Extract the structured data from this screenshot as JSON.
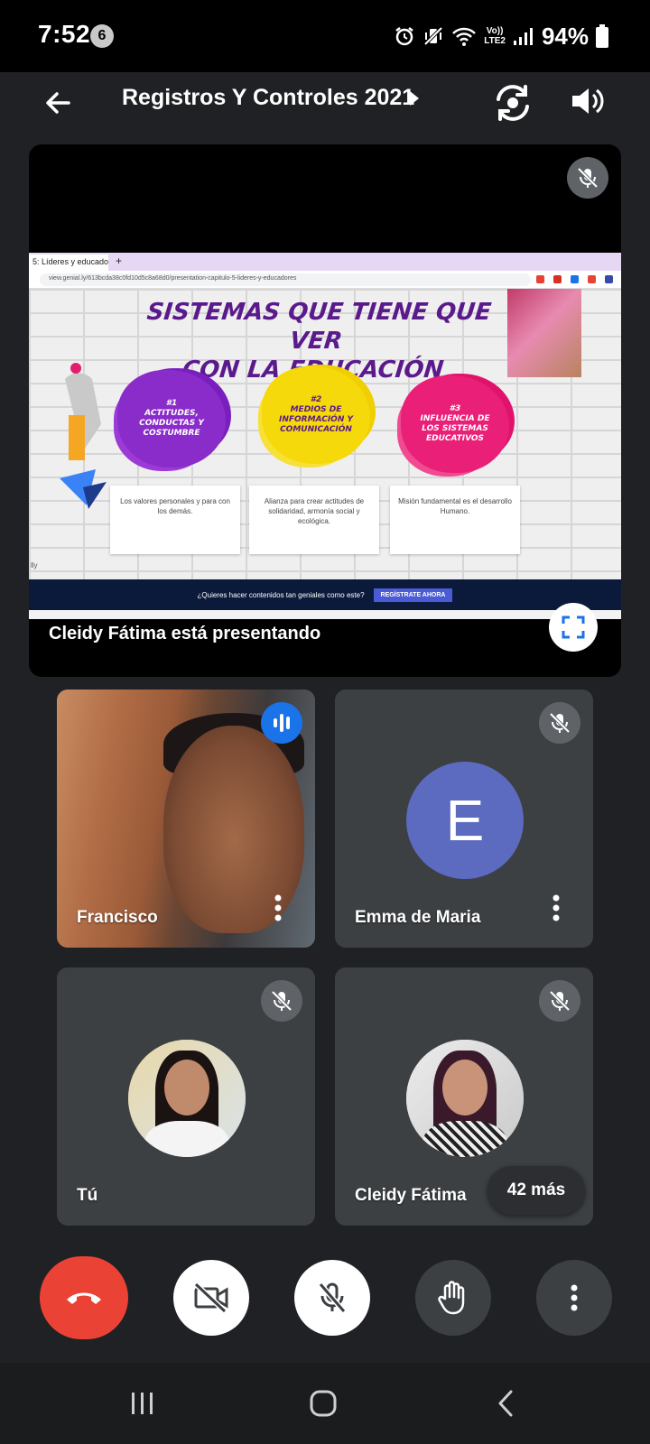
{
  "status_bar": {
    "time": "7:52",
    "notification_count": "6",
    "network_label_top": "Vo))",
    "network_label_bottom": "LTE2",
    "battery": "94%",
    "icons": [
      "alarm-icon",
      "vibrate-icon",
      "wifi-icon",
      "signal-icon",
      "battery-icon"
    ]
  },
  "top_bar": {
    "title": "Registros Y Controles 2021",
    "icons": [
      "back-arrow-icon",
      "caret-right-icon",
      "switch-camera-icon",
      "speaker-icon"
    ]
  },
  "presentation": {
    "presenting_label": "Cleidy Fátima está presentando",
    "browser": {
      "tab_label": "5: Líderes y educadores",
      "url": "view.genial.ly/613bcda38c0fd10d5c8a68d0/presentation-capitulo-5-lideres-y-educadores"
    },
    "slide": {
      "title_line1": "SISTEMAS QUE TIENE QUE VER",
      "title_line2": "CON LA EDUCACIÓN",
      "items": [
        {
          "number": "#1",
          "heading": "ACTITUDES, CONDUCTAS Y COSTUMBRE",
          "text": "Los valores personales y para con los demás."
        },
        {
          "number": "#2",
          "heading": "MEDIOS DE INFORMACIÓN Y COMUNICACIÓN",
          "text": "Alianza para crear actitudes de solidaridad, armonía social y ecológica."
        },
        {
          "number": "#3",
          "heading": "INFLUENCIA DE LOS SISTEMAS EDUCATIVOS",
          "text": "Misión fundamental es el desarrollo Humano."
        }
      ],
      "footer_mark": "lly"
    },
    "cta": {
      "question": "¿Quieres hacer contenidos tan geniales como este?",
      "button": "REGÍSTRATE AHORA"
    }
  },
  "participants": [
    {
      "name": "Francisco",
      "state": "speaking",
      "video": true
    },
    {
      "name": "Emma de Maria",
      "state": "muted",
      "avatar_letter": "E",
      "avatar_color": "#5c6bc0"
    },
    {
      "name": "Tú",
      "state": "muted",
      "avatar": "photo"
    },
    {
      "name": "Cleidy Fátima",
      "state": "muted",
      "avatar": "photo"
    }
  ],
  "more_participants": "42 más",
  "controls": [
    "end-call-icon",
    "camera-off-icon",
    "mic-off-icon",
    "raise-hand-icon",
    "more-vert-icon"
  ],
  "colors": {
    "background": "#202124",
    "tile": "#3c4043",
    "end_call": "#ea4335",
    "speaking": "#1a73e8"
  }
}
